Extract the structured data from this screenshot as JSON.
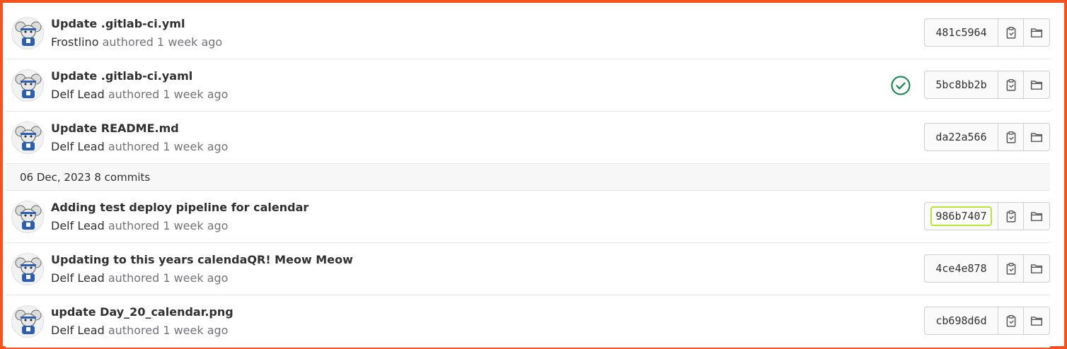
{
  "colors": {
    "frame": "#f4511e",
    "pipeline_success": "#108548",
    "focus_ring": "#b8e633",
    "muted_text": "#737278"
  },
  "icons": {
    "pipeline": "check-circle-icon",
    "copy": "clipboard-icon",
    "browse": "folder-icon"
  },
  "day_group": {
    "date": "06 Dec, 2023",
    "count": "8 commits"
  },
  "authored_text": "authored",
  "commits": [
    {
      "title": "Update .gitlab-ci.yml",
      "author": "Frostlino",
      "time": "1 week ago",
      "sha": "481c5964",
      "pipeline": ""
    },
    {
      "title": "Update .gitlab-ci.yaml",
      "author": "Delf Lead",
      "time": "1 week ago",
      "sha": "5bc8bb2b",
      "pipeline": "passed"
    },
    {
      "title": "Update README.md",
      "author": "Delf Lead",
      "time": "1 week ago",
      "sha": "da22a566",
      "pipeline": ""
    },
    {
      "title": "Adding test deploy pipeline for calendar",
      "author": "Delf Lead",
      "time": "1 week ago",
      "sha": "986b7407",
      "pipeline": ""
    },
    {
      "title": "Updating to this years calendaQR! Meow Meow",
      "author": "Delf Lead",
      "time": "1 week ago",
      "sha": "4ce4e878",
      "pipeline": ""
    },
    {
      "title": "update Day_20_calendar.png",
      "author": "Delf Lead",
      "time": "1 week ago",
      "sha": "cb698d6d",
      "pipeline": ""
    }
  ]
}
